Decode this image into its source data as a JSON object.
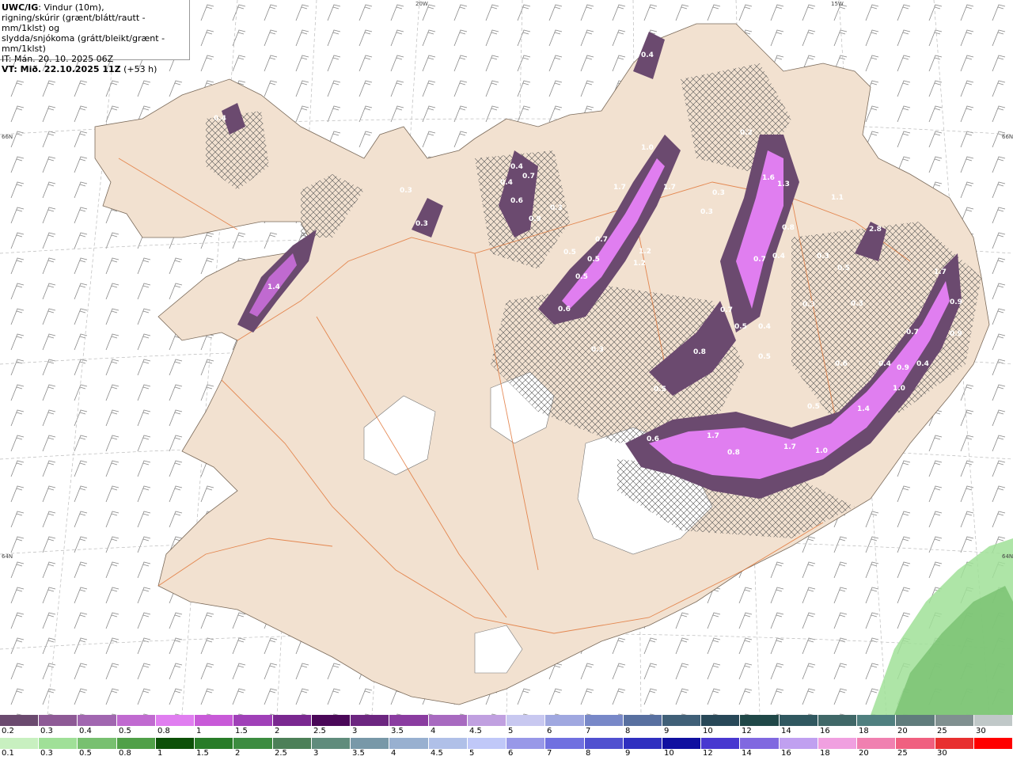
{
  "header": {
    "model": "UWC/IG",
    "line1": ": Vindur (10m),",
    "line2": "rigning/skúrir (grænt/blátt/rautt - mm/1klst) og",
    "line3": "slydda/snjókoma (grátt/bleikt/grænt - mm/1klst)",
    "init_time": "IT: Mán. 20. 10. 2025 06Z",
    "valid_time": "VT: Mið. 22.10.2025 11Z",
    "lead": "(+53 h)"
  },
  "grid_labels": {
    "top_20w": "20W",
    "top_15w": "15W",
    "left_66n": "66N",
    "right_66n": "66N",
    "left_64n": "64N",
    "right_64n": "64N"
  },
  "map_labels": [
    "0.4",
    "0.4",
    "0.4",
    "0.7",
    "0.4",
    "0.6",
    "0.9",
    "0.3",
    "0.3",
    "0.3",
    "1.4",
    "0.5",
    "0.7",
    "0.5",
    "0.5",
    "0.6",
    "0.3",
    "1.7",
    "1.7",
    "1.0",
    "1.2",
    "1.2",
    "0.3",
    "0.2",
    "1.6",
    "1.3",
    "1.1",
    "0.3",
    "0.8",
    "0.7",
    "0.4",
    "0.3",
    "0.7",
    "0.5",
    "0.4",
    "0.8",
    "0.5",
    "0.3",
    "2.8",
    "0.5",
    "0.3",
    "1.7",
    "0.9",
    "0.7",
    "0.9",
    "0.4",
    "0.6",
    "0.4",
    "0.9",
    "1.0",
    "1.4",
    "0.5",
    "0.6",
    "1.7",
    "0.8",
    "1.7",
    "1.0",
    "0.5"
  ],
  "legend": {
    "snow": {
      "labels": [
        "0.2",
        "0.3",
        "0.4",
        "0.5",
        "0.8",
        "1",
        "1.5",
        "2",
        "2.5",
        "3",
        "3.5",
        "4",
        "4.5",
        "5",
        "6",
        "7",
        "8",
        "9",
        "10",
        "12",
        "14",
        "16",
        "18",
        "20",
        "25",
        "30"
      ],
      "colors": [
        "#6b4a6f",
        "#8e5a96",
        "#a166b0",
        "#c06ad0",
        "#e07ef0",
        "#c85ad8",
        "#a040b8",
        "#7a2890",
        "#4a0858",
        "#6c2680",
        "#8a3ca0",
        "#a86ac0",
        "#c0a0e0",
        "#c8c8f0",
        "#a0a8e0",
        "#7888c8",
        "#5870a0",
        "#406078",
        "#284858",
        "#204848",
        "#305860",
        "#406868",
        "#508080",
        "#607c7c",
        "#809090",
        "#c0c8c8"
      ]
    },
    "rain": {
      "labels": [
        "0.1",
        "0.3",
        "0.5",
        "0.8",
        "1",
        "1.5",
        "2",
        "2.5",
        "3",
        "3.5",
        "4",
        "4.5",
        "5",
        "6",
        "7",
        "8",
        "9",
        "10",
        "12",
        "14",
        "16",
        "18",
        "20",
        "25",
        "30"
      ],
      "colors": [
        "#c8f0c0",
        "#a0e098",
        "#78c070",
        "#50a048",
        "#0c5008",
        "#287c28",
        "#3c8c40",
        "#4c8058",
        "#608c7c",
        "#7898a8",
        "#98b0d0",
        "#b0c0e8",
        "#c0c8f8",
        "#9898e8",
        "#7070e0",
        "#5050d0",
        "#3030c0",
        "#1010a0",
        "#4838d0",
        "#8068e0",
        "#c0a0f0",
        "#f0a0e0",
        "#f080b0",
        "#f06080",
        "#e83030",
        "#ff0000"
      ]
    }
  }
}
